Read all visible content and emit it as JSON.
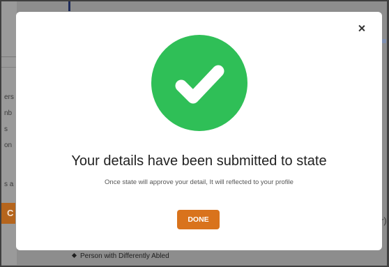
{
  "background": {
    "sidebar_fragments": [
      "ers",
      "nb",
      "s",
      "on",
      "s a"
    ],
    "action_fragment": "C",
    "right_fragment": "r)",
    "bottom_item": "Person with Differently Abled"
  },
  "modal": {
    "title": "Your details have been submitted to state",
    "message": "Once state will approve your detail, It will reflected to your profile",
    "done_label": "DONE",
    "icon": "check-circle-icon",
    "icon_color": "#2fbf57",
    "button_color": "#d9731c"
  }
}
